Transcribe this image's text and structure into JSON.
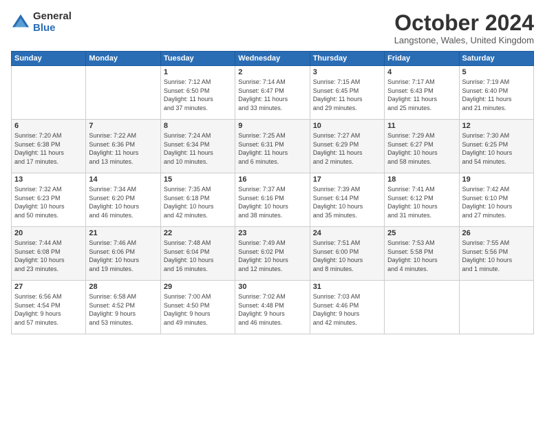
{
  "logo": {
    "general": "General",
    "blue": "Blue"
  },
  "title": "October 2024",
  "subtitle": "Langstone, Wales, United Kingdom",
  "days_of_week": [
    "Sunday",
    "Monday",
    "Tuesday",
    "Wednesday",
    "Thursday",
    "Friday",
    "Saturday"
  ],
  "weeks": [
    [
      {
        "day": "",
        "detail": ""
      },
      {
        "day": "",
        "detail": ""
      },
      {
        "day": "1",
        "detail": "Sunrise: 7:12 AM\nSunset: 6:50 PM\nDaylight: 11 hours\nand 37 minutes."
      },
      {
        "day": "2",
        "detail": "Sunrise: 7:14 AM\nSunset: 6:47 PM\nDaylight: 11 hours\nand 33 minutes."
      },
      {
        "day": "3",
        "detail": "Sunrise: 7:15 AM\nSunset: 6:45 PM\nDaylight: 11 hours\nand 29 minutes."
      },
      {
        "day": "4",
        "detail": "Sunrise: 7:17 AM\nSunset: 6:43 PM\nDaylight: 11 hours\nand 25 minutes."
      },
      {
        "day": "5",
        "detail": "Sunrise: 7:19 AM\nSunset: 6:40 PM\nDaylight: 11 hours\nand 21 minutes."
      }
    ],
    [
      {
        "day": "6",
        "detail": "Sunrise: 7:20 AM\nSunset: 6:38 PM\nDaylight: 11 hours\nand 17 minutes."
      },
      {
        "day": "7",
        "detail": "Sunrise: 7:22 AM\nSunset: 6:36 PM\nDaylight: 11 hours\nand 13 minutes."
      },
      {
        "day": "8",
        "detail": "Sunrise: 7:24 AM\nSunset: 6:34 PM\nDaylight: 11 hours\nand 10 minutes."
      },
      {
        "day": "9",
        "detail": "Sunrise: 7:25 AM\nSunset: 6:31 PM\nDaylight: 11 hours\nand 6 minutes."
      },
      {
        "day": "10",
        "detail": "Sunrise: 7:27 AM\nSunset: 6:29 PM\nDaylight: 11 hours\nand 2 minutes."
      },
      {
        "day": "11",
        "detail": "Sunrise: 7:29 AM\nSunset: 6:27 PM\nDaylight: 10 hours\nand 58 minutes."
      },
      {
        "day": "12",
        "detail": "Sunrise: 7:30 AM\nSunset: 6:25 PM\nDaylight: 10 hours\nand 54 minutes."
      }
    ],
    [
      {
        "day": "13",
        "detail": "Sunrise: 7:32 AM\nSunset: 6:23 PM\nDaylight: 10 hours\nand 50 minutes."
      },
      {
        "day": "14",
        "detail": "Sunrise: 7:34 AM\nSunset: 6:20 PM\nDaylight: 10 hours\nand 46 minutes."
      },
      {
        "day": "15",
        "detail": "Sunrise: 7:35 AM\nSunset: 6:18 PM\nDaylight: 10 hours\nand 42 minutes."
      },
      {
        "day": "16",
        "detail": "Sunrise: 7:37 AM\nSunset: 6:16 PM\nDaylight: 10 hours\nand 38 minutes."
      },
      {
        "day": "17",
        "detail": "Sunrise: 7:39 AM\nSunset: 6:14 PM\nDaylight: 10 hours\nand 35 minutes."
      },
      {
        "day": "18",
        "detail": "Sunrise: 7:41 AM\nSunset: 6:12 PM\nDaylight: 10 hours\nand 31 minutes."
      },
      {
        "day": "19",
        "detail": "Sunrise: 7:42 AM\nSunset: 6:10 PM\nDaylight: 10 hours\nand 27 minutes."
      }
    ],
    [
      {
        "day": "20",
        "detail": "Sunrise: 7:44 AM\nSunset: 6:08 PM\nDaylight: 10 hours\nand 23 minutes."
      },
      {
        "day": "21",
        "detail": "Sunrise: 7:46 AM\nSunset: 6:06 PM\nDaylight: 10 hours\nand 19 minutes."
      },
      {
        "day": "22",
        "detail": "Sunrise: 7:48 AM\nSunset: 6:04 PM\nDaylight: 10 hours\nand 16 minutes."
      },
      {
        "day": "23",
        "detail": "Sunrise: 7:49 AM\nSunset: 6:02 PM\nDaylight: 10 hours\nand 12 minutes."
      },
      {
        "day": "24",
        "detail": "Sunrise: 7:51 AM\nSunset: 6:00 PM\nDaylight: 10 hours\nand 8 minutes."
      },
      {
        "day": "25",
        "detail": "Sunrise: 7:53 AM\nSunset: 5:58 PM\nDaylight: 10 hours\nand 4 minutes."
      },
      {
        "day": "26",
        "detail": "Sunrise: 7:55 AM\nSunset: 5:56 PM\nDaylight: 10 hours\nand 1 minute."
      }
    ],
    [
      {
        "day": "27",
        "detail": "Sunrise: 6:56 AM\nSunset: 4:54 PM\nDaylight: 9 hours\nand 57 minutes."
      },
      {
        "day": "28",
        "detail": "Sunrise: 6:58 AM\nSunset: 4:52 PM\nDaylight: 9 hours\nand 53 minutes."
      },
      {
        "day": "29",
        "detail": "Sunrise: 7:00 AM\nSunset: 4:50 PM\nDaylight: 9 hours\nand 49 minutes."
      },
      {
        "day": "30",
        "detail": "Sunrise: 7:02 AM\nSunset: 4:48 PM\nDaylight: 9 hours\nand 46 minutes."
      },
      {
        "day": "31",
        "detail": "Sunrise: 7:03 AM\nSunset: 4:46 PM\nDaylight: 9 hours\nand 42 minutes."
      },
      {
        "day": "",
        "detail": ""
      },
      {
        "day": "",
        "detail": ""
      }
    ]
  ]
}
